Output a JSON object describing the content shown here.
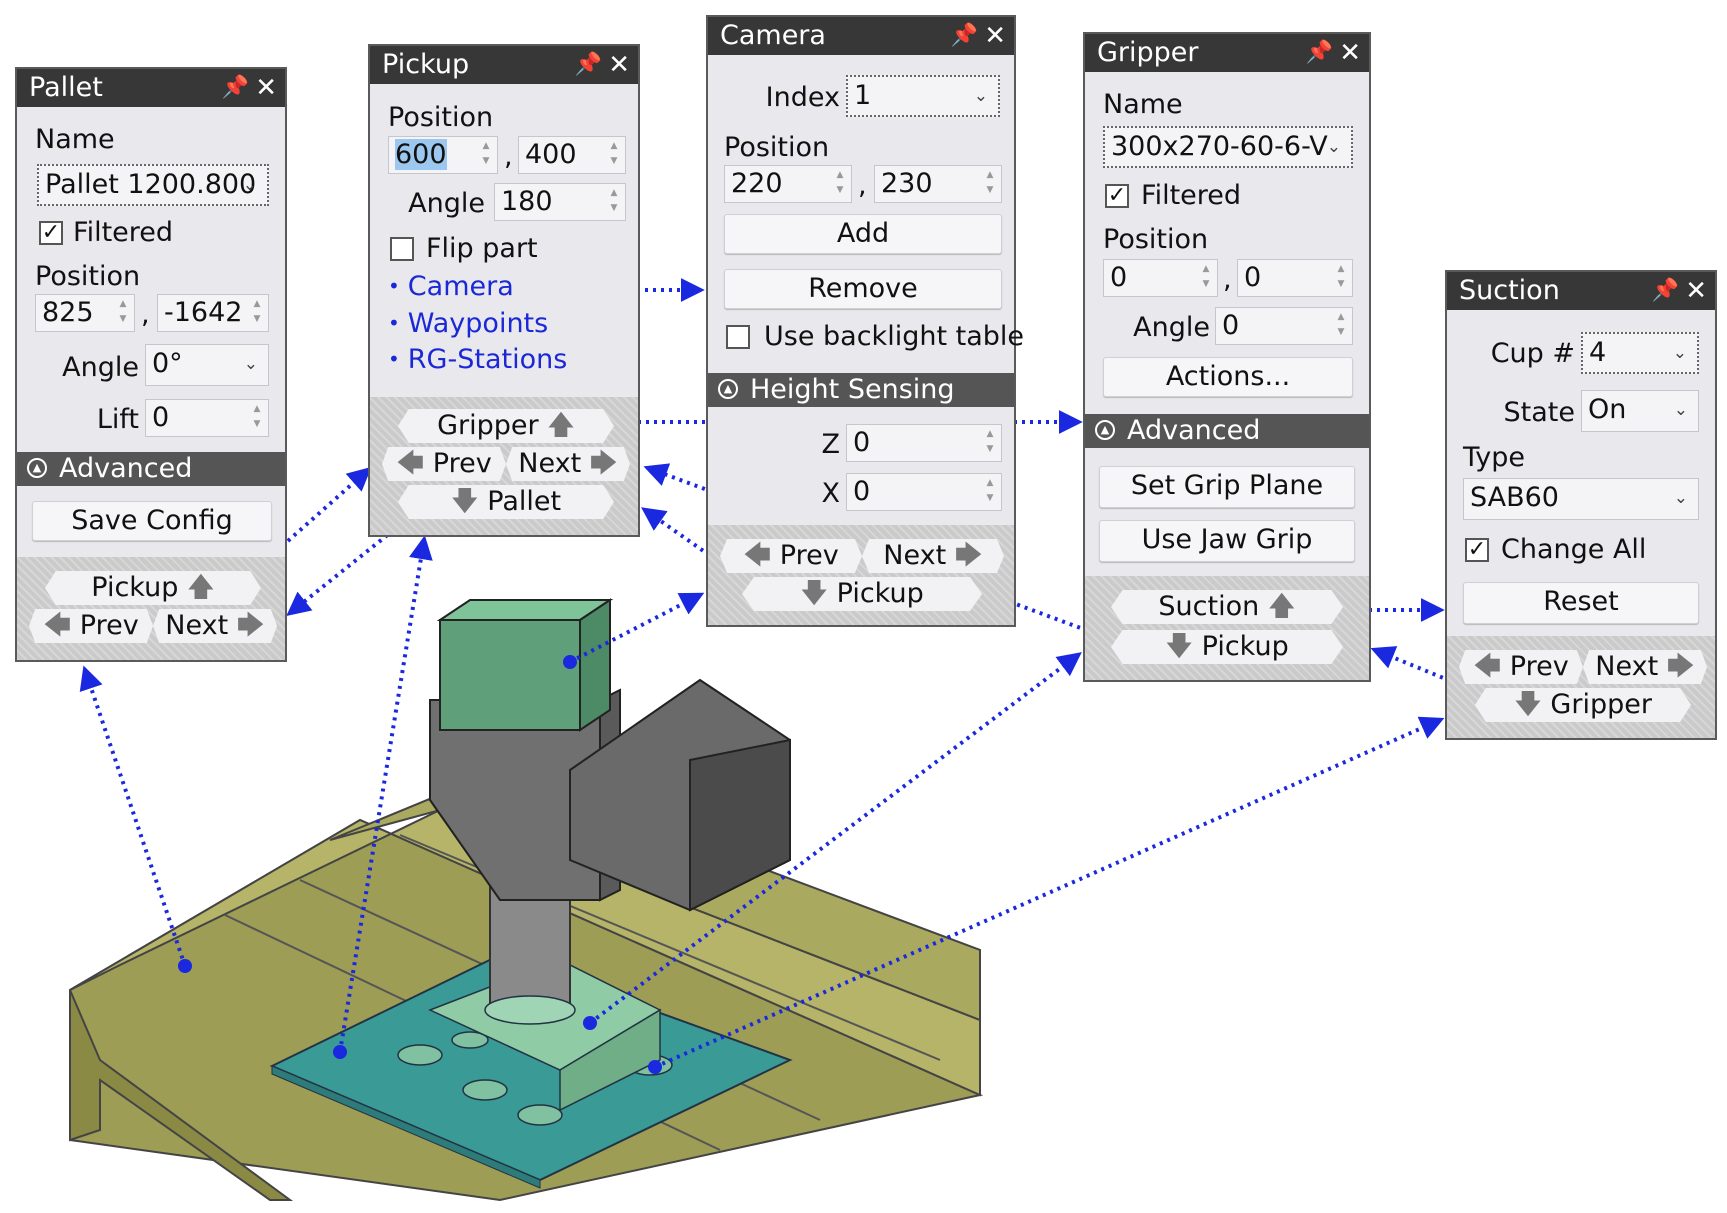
{
  "pallet": {
    "title": "Pallet",
    "name_label": "Name",
    "name_value": "Pallet 1200.800",
    "filtered_label": "Filtered",
    "filtered_checked": true,
    "position_label": "Position",
    "pos_x": "825",
    "pos_sep": ",",
    "pos_y": "-1642",
    "angle_label": "Angle",
    "angle_value": "0°",
    "lift_label": "Lift",
    "lift_value": "0",
    "advanced_label": "Advanced",
    "save_config": "Save Config",
    "nav_up": "Pickup",
    "nav_prev": "Prev",
    "nav_next": "Next"
  },
  "pickup": {
    "title": "Pickup",
    "position_label": "Position",
    "pos_x": "600",
    "pos_sep": ",",
    "pos_y": "400",
    "angle_label": "Angle",
    "angle_value": "180",
    "flip_label": "Flip part",
    "flip_checked": false,
    "links": [
      "Camera",
      "Waypoints",
      "RG-Stations"
    ],
    "nav_up": "Gripper",
    "nav_prev": "Prev",
    "nav_next": "Next",
    "nav_down": "Pallet"
  },
  "camera": {
    "title": "Camera",
    "index_label": "Index",
    "index_value": "1",
    "position_label": "Position",
    "pos_x": "220",
    "pos_sep": ",",
    "pos_y": "230",
    "add_label": "Add",
    "remove_label": "Remove",
    "backlight_label": "Use backlight table",
    "backlight_checked": false,
    "height_sensing_label": "Height Sensing",
    "z_label": "Z",
    "z_value": "0",
    "x_label": "X",
    "x_value": "0",
    "nav_prev": "Prev",
    "nav_next": "Next",
    "nav_down": "Pickup"
  },
  "gripper": {
    "title": "Gripper",
    "name_label": "Name",
    "name_value": "300x270-60-6-V",
    "filtered_label": "Filtered",
    "filtered_checked": true,
    "position_label": "Position",
    "pos_x": "0",
    "pos_sep": ",",
    "pos_y": "0",
    "angle_label": "Angle",
    "angle_value": "0",
    "actions_label": "Actions...",
    "advanced_label": "Advanced",
    "set_grip_plane": "Set Grip Plane",
    "use_jaw_grip": "Use Jaw Grip",
    "nav_up": "Suction",
    "nav_down": "Pickup"
  },
  "suction": {
    "title": "Suction",
    "cup_label": "Cup #",
    "cup_value": "4",
    "state_label": "State",
    "state_value": "On",
    "type_label": "Type",
    "type_value": "SAB60",
    "change_all_label": "Change All",
    "change_all_checked": true,
    "reset_label": "Reset",
    "nav_prev": "Prev",
    "nav_next": "Next",
    "nav_down": "Gripper"
  },
  "colors": {
    "title_bar": "#373737",
    "section_bar": "#555555",
    "panel_bg": "#e9e9ed",
    "link": "#1b28d6",
    "connector": "#1a28e0",
    "pallet_board": "#a3a35a",
    "gripper_plate": "#3a9a96",
    "camera_housing": "#5fa07a",
    "robot_body": "#707070"
  },
  "icons": {
    "pin": "pin-icon",
    "close": "close-icon",
    "collapse": "collapse-circle-icon",
    "arrow_up": "arrow-up-icon",
    "arrow_down": "arrow-down-icon",
    "arrow_left": "arrow-left-icon",
    "arrow_right": "arrow-right-icon",
    "dropdown": "chevron-down-icon"
  }
}
